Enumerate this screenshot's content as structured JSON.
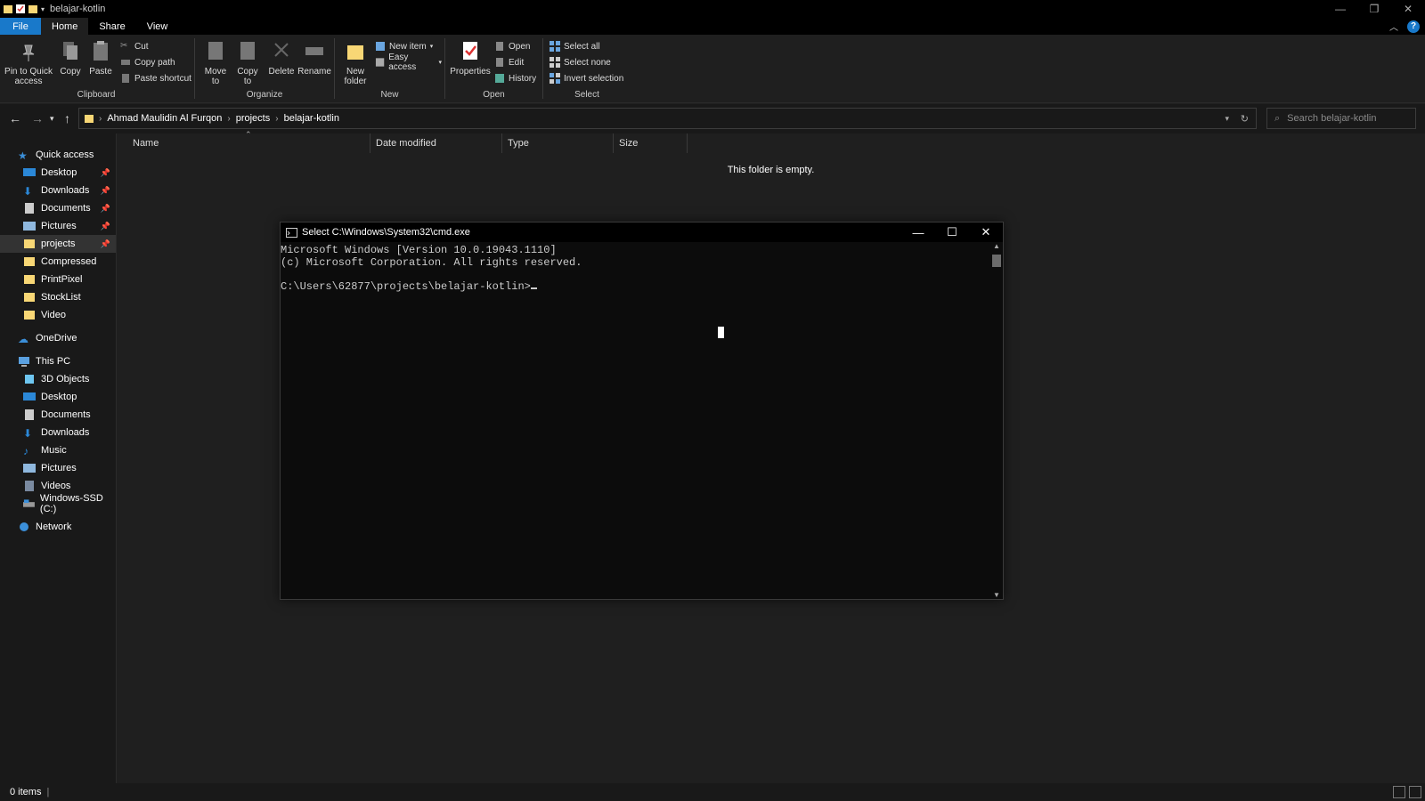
{
  "window": {
    "title": "belajar-kotlin"
  },
  "menu": {
    "file": "File",
    "home": "Home",
    "share": "Share",
    "view": "View"
  },
  "ribbon": {
    "clipboard": {
      "pin": "Pin to Quick access",
      "copy": "Copy",
      "paste": "Paste",
      "cut": "Cut",
      "copy_path": "Copy path",
      "paste_shortcut": "Paste shortcut",
      "label": "Clipboard"
    },
    "organize": {
      "move_to": "Move to",
      "copy_to": "Copy to",
      "delete": "Delete",
      "rename": "Rename",
      "label": "Organize"
    },
    "new": {
      "new_folder": "New folder",
      "new_item": "New item",
      "easy_access": "Easy access",
      "label": "New"
    },
    "open": {
      "properties": "Properties",
      "open": "Open",
      "edit": "Edit",
      "history": "History",
      "label": "Open"
    },
    "select": {
      "select_all": "Select all",
      "select_none": "Select none",
      "invert": "Invert selection",
      "label": "Select"
    }
  },
  "address": {
    "crumbs": [
      "Ahmad Maulidin Al Furqon",
      "projects",
      "belajar-kotlin"
    ]
  },
  "search": {
    "placeholder": "Search belajar-kotlin"
  },
  "nav": {
    "quick_access": "Quick access",
    "quick_items": [
      "Desktop",
      "Downloads",
      "Documents",
      "Pictures",
      "projects",
      "Compressed",
      "PrintPixel",
      "StockList",
      "Video"
    ],
    "onedrive": "OneDrive",
    "this_pc": "This PC",
    "pc_items": [
      "3D Objects",
      "Desktop",
      "Documents",
      "Downloads",
      "Music",
      "Pictures",
      "Videos",
      "Windows-SSD (C:)"
    ],
    "network": "Network"
  },
  "columns": {
    "name": "Name",
    "date": "Date modified",
    "type": "Type",
    "size": "Size"
  },
  "empty_text": "This folder is empty.",
  "cmd": {
    "title": "Select C:\\Windows\\System32\\cmd.exe",
    "lines": [
      "Microsoft Windows [Version 10.0.19043.1110]",
      "(c) Microsoft Corporation. All rights reserved.",
      "",
      "C:\\Users\\62877\\projects\\belajar-kotlin>"
    ]
  },
  "status": {
    "items": "0 items"
  },
  "colors": {
    "accent": "#1979ca",
    "background": "#1f1f1f",
    "console": "#0c0c0c"
  }
}
